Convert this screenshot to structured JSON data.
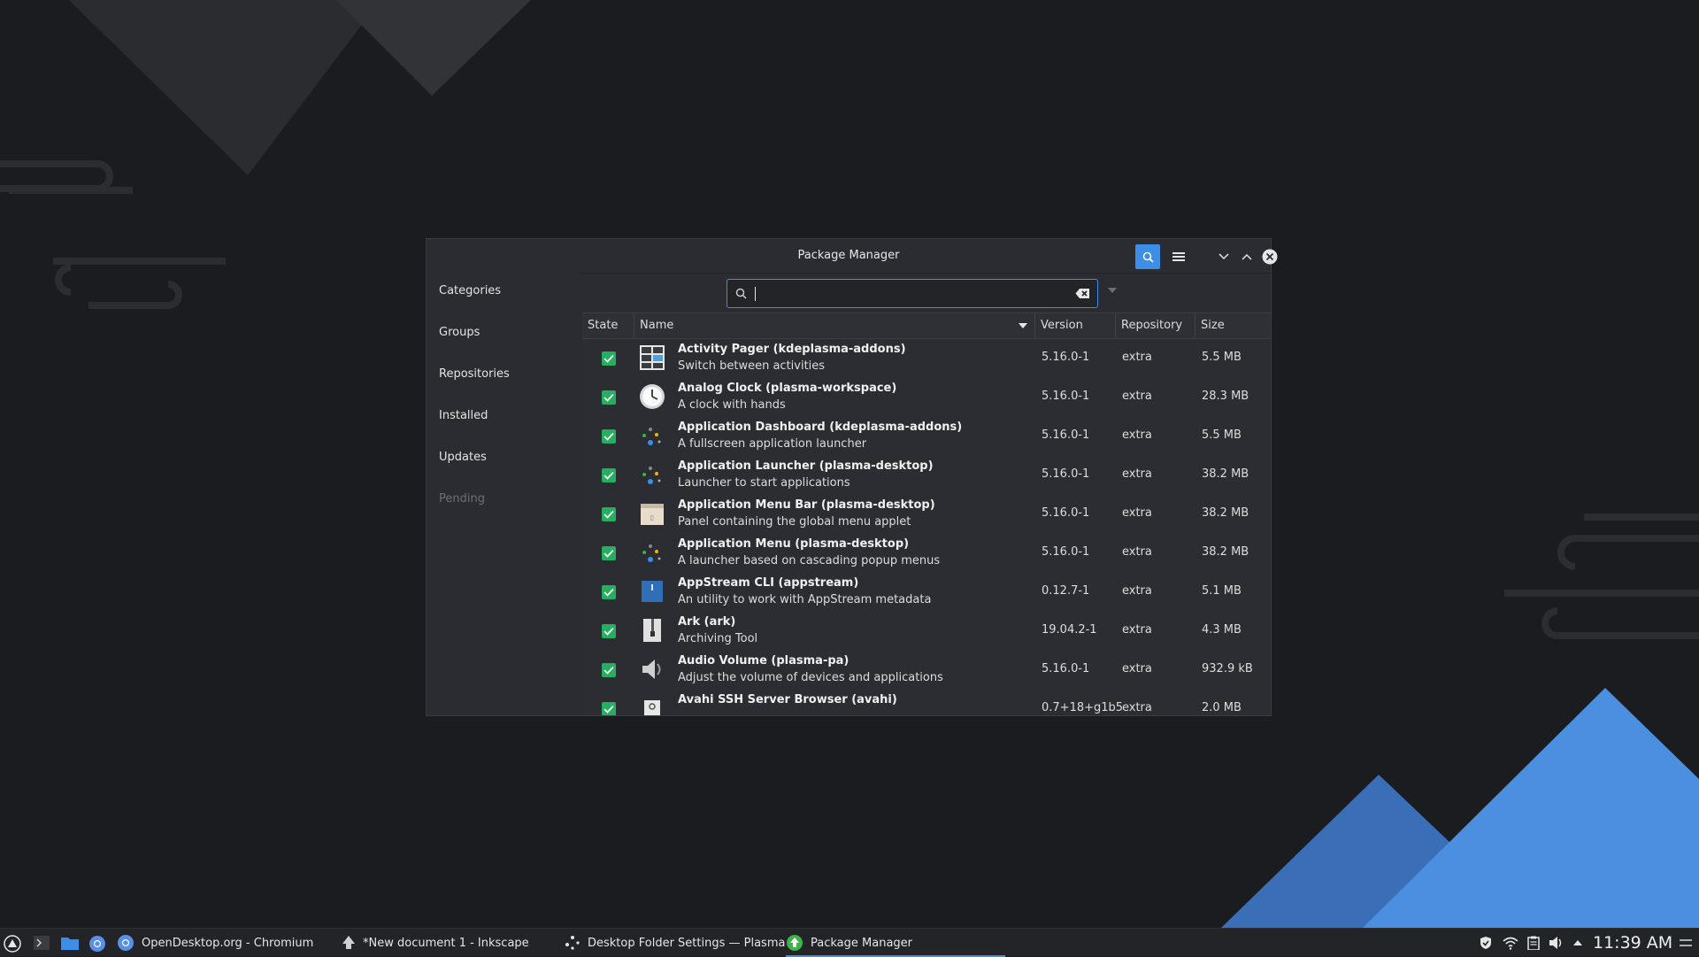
{
  "colors": {
    "accent": "#3d8ee6",
    "check_green": "#27ae60",
    "window_bg": "#2a2c31",
    "desktop_bg": "#1b1c20"
  },
  "window": {
    "title": "Package Manager",
    "icons": {
      "search": "search-icon",
      "menu": "hamburger-menu-icon",
      "minimize": "chevron-down-icon",
      "maximize": "chevron-up-icon",
      "close": "close-icon"
    }
  },
  "sidebar": {
    "items": [
      {
        "label": "Categories"
      },
      {
        "label": "Groups"
      },
      {
        "label": "Repositories"
      },
      {
        "label": "Installed"
      },
      {
        "label": "Updates"
      },
      {
        "label": "Pending"
      }
    ]
  },
  "search": {
    "value": "",
    "placeholder": ""
  },
  "table": {
    "columns": {
      "state": "State",
      "name": "Name",
      "version": "Version",
      "repository": "Repository",
      "size": "Size"
    },
    "rows": [
      {
        "name": "Activity Pager  (kdeplasma-addons)",
        "description": "Switch between activities",
        "version": "5.16.0-1",
        "repository": "extra",
        "size": "5.5 MB",
        "icon": "activity-pager-icon"
      },
      {
        "name": "Analog Clock  (plasma-workspace)",
        "description": "A clock with hands",
        "version": "5.16.0-1",
        "repository": "extra",
        "size": "28.3 MB",
        "icon": "clock-icon"
      },
      {
        "name": "Application Dashboard  (kdeplasma-addons)",
        "description": "A fullscreen application launcher",
        "version": "5.16.0-1",
        "repository": "extra",
        "size": "5.5 MB",
        "icon": "launcher-icon"
      },
      {
        "name": "Application Launcher  (plasma-desktop)",
        "description": "Launcher to start applications",
        "version": "5.16.0-1",
        "repository": "extra",
        "size": "38.2 MB",
        "icon": "launcher-icon"
      },
      {
        "name": "Application Menu Bar  (plasma-desktop)",
        "description": "Panel containing the global menu applet",
        "version": "5.16.0-1",
        "repository": "extra",
        "size": "38.2 MB",
        "icon": "menu-bar-icon"
      },
      {
        "name": "Application Menu  (plasma-desktop)",
        "description": "A launcher based on cascading popup menus",
        "version": "5.16.0-1",
        "repository": "extra",
        "size": "38.2 MB",
        "icon": "launcher-icon"
      },
      {
        "name": "AppStream CLI  (appstream)",
        "description": "An utility to work with AppStream metadata",
        "version": "0.12.7-1",
        "repository": "extra",
        "size": "5.1 MB",
        "icon": "appstream-icon"
      },
      {
        "name": "Ark  (ark)",
        "description": "Archiving Tool",
        "version": "19.04.2-1",
        "repository": "extra",
        "size": "4.3 MB",
        "icon": "archive-icon"
      },
      {
        "name": "Audio Volume  (plasma-pa)",
        "description": "Adjust the volume of devices and applications",
        "version": "5.16.0-1",
        "repository": "extra",
        "size": "932.9 kB",
        "icon": "speaker-icon"
      },
      {
        "name": "Avahi SSH Server Browser  (avahi)",
        "description": "",
        "version": "0.7+18+g1b5",
        "repository": "extra",
        "size": "2.0 MB",
        "icon": "network-icon"
      }
    ]
  },
  "taskbar": {
    "tasks": [
      {
        "label": "OpenDesktop.org - Chromium",
        "icon": "chromium-icon"
      },
      {
        "label": "*New document 1 - Inkscape",
        "icon": "inkscape-icon"
      },
      {
        "label": "Desktop Folder Settings — Plasma",
        "icon": "plasma-icon"
      },
      {
        "label": "Package Manager",
        "icon": "package-manager-icon"
      }
    ],
    "clock": "11:39 AM"
  }
}
